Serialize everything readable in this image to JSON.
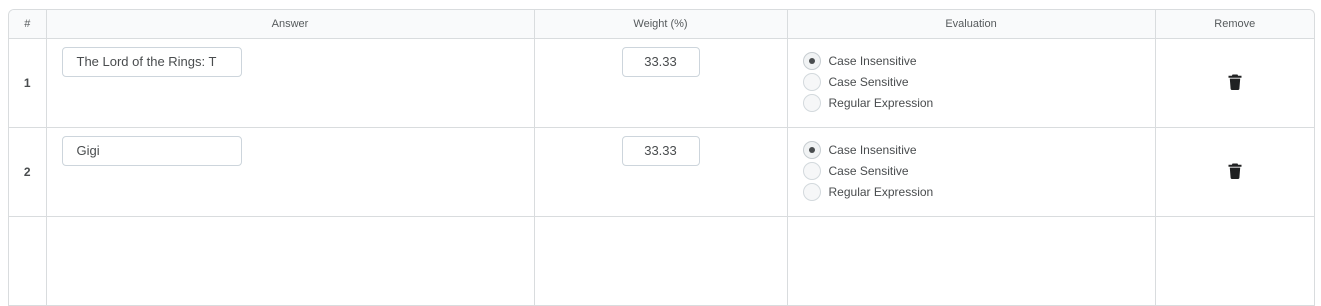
{
  "headers": {
    "num": "#",
    "answer": "Answer",
    "weight": "Weight (%)",
    "evaluation": "Evaluation",
    "remove": "Remove"
  },
  "rows": [
    {
      "num": "1",
      "answer": "The Lord of the Rings: T",
      "weight": "33.33",
      "options": [
        {
          "label": "Case Insensitive",
          "checked": true
        },
        {
          "label": "Case Sensitive",
          "checked": false
        },
        {
          "label": "Regular Expression",
          "checked": false
        }
      ],
      "remove_icon": "trash-icon"
    },
    {
      "num": "2",
      "answer": "Gigi",
      "weight": "33.33",
      "options": [
        {
          "label": "Case Insensitive",
          "checked": true
        },
        {
          "label": "Case Sensitive",
          "checked": false
        },
        {
          "label": "Regular Expression",
          "checked": false
        }
      ],
      "remove_icon": "trash-icon"
    }
  ],
  "colors": {
    "border": "#d9dcde",
    "header_bg": "#f9fafb",
    "text": "#494c4e",
    "icon": "#202122"
  }
}
